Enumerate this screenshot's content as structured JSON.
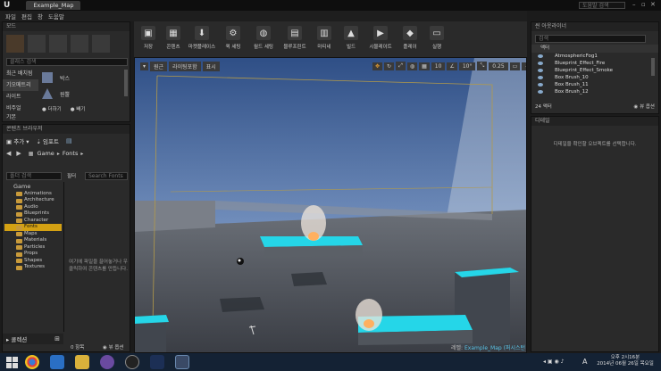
{
  "window": {
    "tab": "Example_Map",
    "search_placeholder": "도움말 검색"
  },
  "menu": [
    "파일",
    "편집",
    "창",
    "도움말"
  ],
  "modes": {
    "header": "모드",
    "search_placeholder": "클래스 검색",
    "categories": [
      "최근 배치됨",
      "기오메트리",
      "라이트",
      "비주얼",
      "기본"
    ],
    "items": [
      "박스",
      "원뿔"
    ],
    "opt1": "더하기",
    "opt2": "빼기"
  },
  "toolbar": {
    "buttons": [
      "저장",
      "콘텐츠",
      "마켓플레이스",
      "퀵 세팅",
      "월드 세팅",
      "블루프린트",
      "마티네",
      "빌드",
      "시뮬레이트",
      "플레이",
      "실행"
    ]
  },
  "content_browser": {
    "header": "콘텐츠 브라우저",
    "add": "추가",
    "import": "임포트",
    "path": [
      "Game",
      "Fonts"
    ],
    "folder_search": "폴더 검색",
    "filter": "필터",
    "search": "Search Fonts",
    "tree_root": "Game",
    "folders": [
      "Animations",
      "Architecture",
      "Audio",
      "Blueprints",
      "Character",
      "Fonts",
      "Maps",
      "Materials",
      "Particles",
      "Props",
      "Shapes",
      "Textures"
    ],
    "empty_msg": "여기에 파일을 끌어놓거나 우클릭하여 콘텐츠를 만듭니다.",
    "collections": "콜렉션",
    "count": "0 항목",
    "view": "뷰 옵션"
  },
  "viewport": {
    "perspective": "원근",
    "lit": "라이팅포함",
    "show": "표시",
    "grid": "10",
    "angle": "10°",
    "scale": "0.25",
    "cam": "4",
    "level_label": "레벨:",
    "level_name": "Example_Map (퍼시스턴트)"
  },
  "outliner": {
    "header": "씬 아웃라이너",
    "search_placeholder": "검색",
    "col": "액터",
    "items": [
      "AtmosphericFog1",
      "Blueprint_Effect_Fire",
      "Blueprint_Effect_Smoke",
      "Box Brush_10",
      "Box Brush_11",
      "Box Brush_12"
    ],
    "count": "24 액터",
    "view": "뷰 옵션"
  },
  "details": {
    "header": "디테일",
    "msg": "디테일을 확인할 오브젝트를 선택합니다."
  },
  "taskbar": {
    "time": "오후 2시16분",
    "date": "2014년 06월 26일 목요일",
    "lang": "A"
  }
}
